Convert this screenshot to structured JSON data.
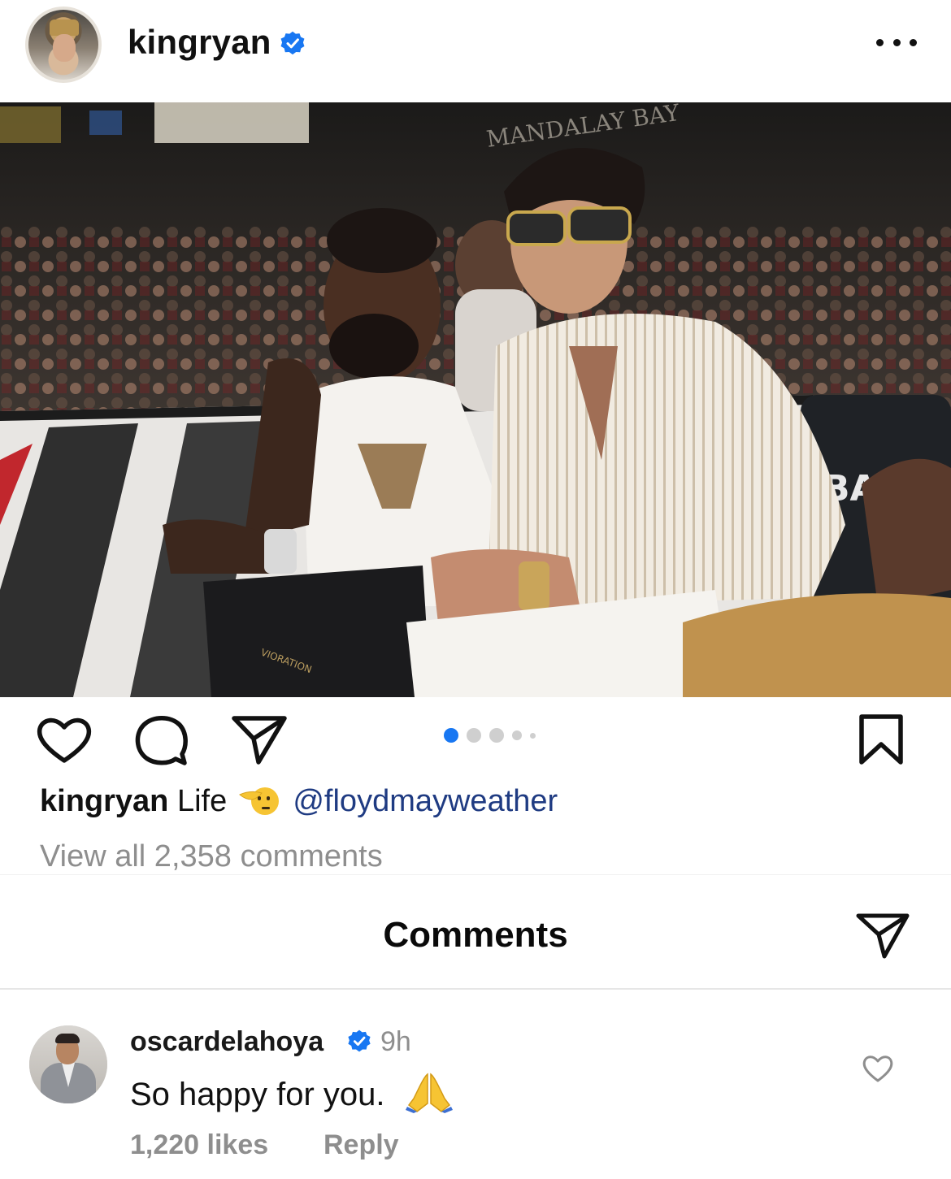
{
  "header": {
    "username": "kingryan",
    "verified": true,
    "more_icon": "more-horizontal-icon"
  },
  "photo": {
    "signage": "MANDALAY BAY",
    "banner_text": "BA",
    "bag_text": "VIORATION"
  },
  "actions": {
    "like_icon": "heart-icon",
    "comment_icon": "comment-icon",
    "share_icon": "paper-plane-icon",
    "save_icon": "bookmark-icon",
    "carousel_total": 5,
    "carousel_active": 1,
    "carousel_active_color": "#1877f2"
  },
  "caption": {
    "username": "kingryan",
    "text": "Life",
    "emoji": "saluting-face",
    "mention": "@floydmayweather"
  },
  "view_comments": "View all 2,358 comments",
  "comments_sheet": {
    "title": "Comments",
    "share_icon": "paper-plane-icon",
    "comments": [
      {
        "username": "oscardelahoya",
        "verified": true,
        "time": "9h",
        "text": "So happy for you.",
        "emoji": "folded-hands",
        "likes": "1,220 likes",
        "reply_label": "Reply"
      }
    ]
  },
  "colors": {
    "verified_blue": "#1877f2",
    "mention_blue": "#1f3b82",
    "secondary_text": "#8e8e8e"
  }
}
